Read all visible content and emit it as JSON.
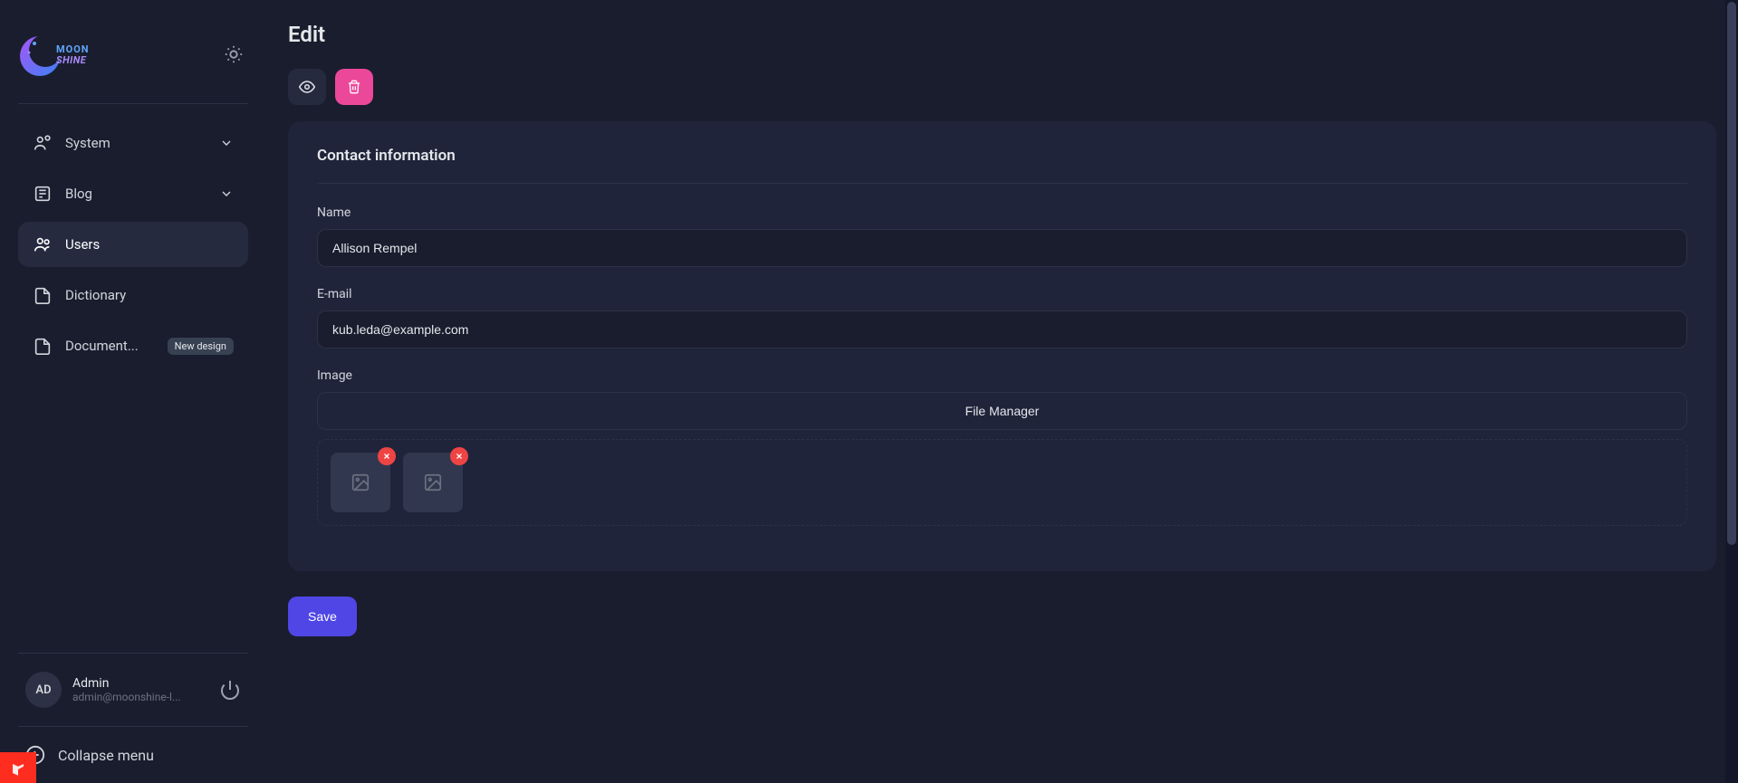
{
  "sidebar": {
    "items": [
      {
        "label": "System",
        "icon": "users-gear",
        "expand": true
      },
      {
        "label": "Blog",
        "icon": "newspaper",
        "expand": true
      },
      {
        "label": "Users",
        "icon": "users",
        "active": true
      },
      {
        "label": "Dictionary",
        "icon": "document"
      },
      {
        "label": "Document...",
        "icon": "document",
        "badge": "New design"
      }
    ],
    "user": {
      "initials": "AD",
      "name": "Admin",
      "email": "admin@moonshine-l..."
    },
    "collapse_label": "Collapse menu"
  },
  "page": {
    "title": "Edit"
  },
  "form": {
    "section_title": "Contact information",
    "name_label": "Name",
    "name_value": "Allison Rempel",
    "email_label": "E-mail",
    "email_value": "kub.leda@example.com",
    "image_label": "Image",
    "file_manager_label": "File Manager",
    "thumbnails": [
      {},
      {}
    ]
  },
  "actions": {
    "save_label": "Save"
  }
}
